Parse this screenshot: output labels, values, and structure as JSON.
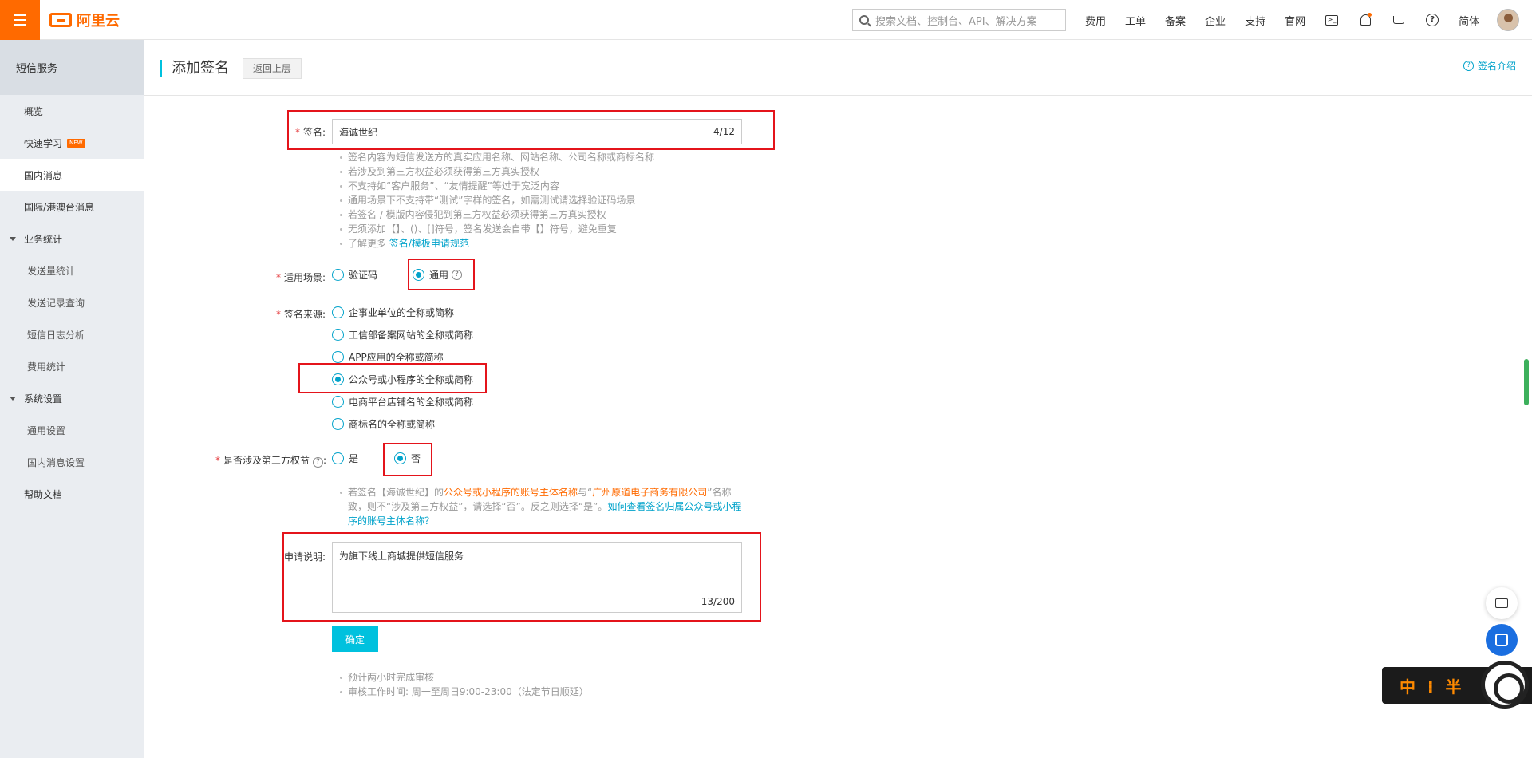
{
  "topbar": {
    "logo_text": "阿里云",
    "search_placeholder": "搜索文档、控制台、API、解决方案",
    "nav": [
      "费用",
      "工单",
      "备案",
      "企业",
      "支持",
      "官网"
    ],
    "language": "简体"
  },
  "sidebar": {
    "title": "短信服务",
    "items": [
      {
        "label": "概览"
      },
      {
        "label": "快速学习",
        "badge": "NEW"
      },
      {
        "label": "国内消息"
      },
      {
        "label": "国际/港澳台消息"
      }
    ],
    "groups": [
      {
        "label": "业务统计",
        "children": [
          "发送量统计",
          "发送记录查询",
          "短信日志分析",
          "费用统计"
        ]
      },
      {
        "label": "系统设置",
        "children": [
          "通用设置",
          "国内消息设置"
        ]
      }
    ],
    "help": "帮助文档"
  },
  "header": {
    "title": "添加签名",
    "back": "返回上层",
    "intro_link": "签名介绍"
  },
  "form": {
    "sign_label": "签名:",
    "sign_value": "海诚世纪",
    "sign_count": "4/12",
    "sign_tips": [
      "签名内容为短信发送方的真实应用名称、网站名称、公司名称或商标名称",
      "若涉及到第三方权益必须获得第三方真实授权",
      "不支持如“客户服务”、“友情提醒”等过于宽泛内容",
      "通用场景下不支持带“测试”字样的签名，如需测试请选择验证码场景",
      "若签名 / 模版内容侵犯到第三方权益必须获得第三方真实授权",
      "无须添加【】、()、[]符号，签名发送会自带【】符号，避免重复"
    ],
    "sign_tip_more_prefix": "了解更多",
    "sign_tip_more_link": "签名/模板申请规范",
    "scene_label": "适用场景:",
    "scene_options": [
      "验证码",
      "通用"
    ],
    "source_label": "签名来源:",
    "source_options": [
      "企事业单位的全称或简称",
      "工信部备案网站的全称或简称",
      "APP应用的全称或简称",
      "公众号或小程序的全称或简称",
      "电商平台店铺名的全称或简称",
      "商标名的全称或简称"
    ],
    "third_label": "是否涉及第三方权益",
    "third_options": [
      "是",
      "否"
    ],
    "third_note": {
      "p1": "若签名【海诚世纪】的",
      "p2": "公众号或小程序的账号主体名称",
      "p3": "与“",
      "p4": "广州原道电子商务有限公司",
      "p5": "”名称一致，则不“涉及第三方权益”，请选择“否”。反之则选择“是”。",
      "link": "如何查看签名归属公众号或小程序的账号主体名称？"
    },
    "desc_label": "申请说明:",
    "desc_value": "为旗下线上商城提供短信服务",
    "desc_count": "13/200",
    "submit": "确定",
    "footer_tips": [
      "预计两小时完成审核",
      "审核工作时间: 周一至周日9:00-23:00（法定节日顺延）"
    ]
  },
  "overlay": {
    "text": "中 ⁝ 半"
  }
}
